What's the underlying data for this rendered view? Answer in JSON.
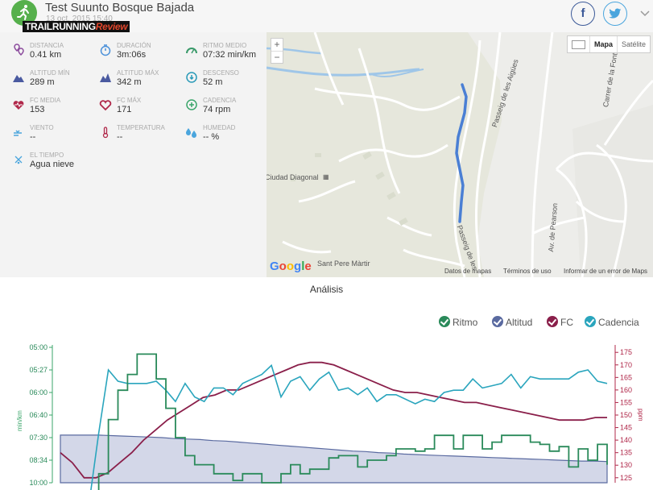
{
  "header": {
    "title": "Test Suunto Bosque Bajada",
    "date": "13 oct. 2015 15:40",
    "logo_main": "TRAILRUNNING",
    "logo_accent": "Review",
    "facebook_label": "f",
    "twitter_label": "t",
    "more_label": "v"
  },
  "stats": [
    {
      "label": "DISTANCIA",
      "value": "0.41 km",
      "icon": "distance-icon",
      "color": "#8b4a9c"
    },
    {
      "label": "DURACIÓN",
      "value": "3m:06s",
      "icon": "stopwatch-icon",
      "color": "#4a90d9"
    },
    {
      "label": "RITMO MEDIO",
      "value": "07:32 min/km",
      "icon": "pace-gauge-icon",
      "color": "#3a9a6a"
    },
    {
      "label": "ALTITUD MÍN",
      "value": "289 m",
      "icon": "mountain-icon",
      "color": "#4a5aa0"
    },
    {
      "label": "ALTITUD MÁX",
      "value": "342 m",
      "icon": "mountain-peak-icon",
      "color": "#4a5aa0"
    },
    {
      "label": "DESCENSO",
      "value": "52 m",
      "icon": "descent-icon",
      "color": "#2a9ab8"
    },
    {
      "label": "FC MEDIA",
      "value": "153",
      "icon": "heart-rate-icon",
      "color": "#b0284a"
    },
    {
      "label": "FC MÁX",
      "value": "171",
      "icon": "heart-icon",
      "color": "#b0284a"
    },
    {
      "label": "CADENCIA",
      "value": "74 rpm",
      "icon": "cadence-icon",
      "color": "#3aa56a"
    },
    {
      "label": "VIENTO",
      "value": "--",
      "icon": "wind-icon",
      "color": "#4aa5dd"
    },
    {
      "label": "TEMPERATURA",
      "value": "--",
      "icon": "thermometer-icon",
      "color": "#b0284a"
    },
    {
      "label": "HUMEDAD",
      "value": "-- %",
      "icon": "humidity-icon",
      "color": "#4aa5dd"
    },
    {
      "label": "EL TIEMPO",
      "value": "Agua nieve",
      "icon": "weather-icon",
      "color": "#4aa5dd"
    }
  ],
  "map": {
    "zoom_in": "+",
    "zoom_out": "−",
    "type_map": "Mapa",
    "type_satellite": "Satélite",
    "place_label": "Ciudad Diagonal",
    "place_label_2": "Sant Pere Màrtir",
    "streets": [
      "Passeig de les Aigües",
      "Carrer de la Font",
      "Av. de Pearson",
      "Passeig de les"
    ],
    "google_letters": [
      "G",
      "o",
      "o",
      "g",
      "l",
      "e"
    ],
    "attribution": [
      "Datos de mapas",
      "Términos de uso",
      "Informar de un error de Maps"
    ],
    "route_color": "#4a7fd4"
  },
  "analysis": {
    "title": "Análisis",
    "legend": [
      {
        "label": "Ritmo",
        "color": "#2a8a5a"
      },
      {
        "label": "Altitud",
        "color": "#5a6aa0"
      },
      {
        "label": "FC",
        "color": "#8a1f4a"
      },
      {
        "label": "Cadencia",
        "color": "#2aa5bd"
      }
    ]
  },
  "chart_data": {
    "type": "line",
    "xlabel": "",
    "y_left": {
      "label": "min/km",
      "ticks": [
        "05:00",
        "05:27",
        "06:00",
        "06:40",
        "07:30",
        "08:34",
        "10:00"
      ],
      "color": "#3aa56a"
    },
    "y_right": {
      "label": "ppm",
      "ticks": [
        175,
        170,
        165,
        160,
        155,
        150,
        145,
        140,
        135,
        130,
        125
      ],
      "ylim": [
        123,
        177
      ],
      "color": "#b0284a"
    },
    "grid": false,
    "series": [
      {
        "name": "Ritmo",
        "color": "#2a8a5a",
        "y_units": "pace_tick_index_0_top_6_bottom",
        "values": [
          6.9,
          6.9,
          6.9,
          6.9,
          5.6,
          3.2,
          1.9,
          1.2,
          0.3,
          0.3,
          1.4,
          2.7,
          4.0,
          4.8,
          5.2,
          5.2,
          5.6,
          5.6,
          5.9,
          5.6,
          5.6,
          6.0,
          6.0,
          5.6,
          5.2,
          5.6,
          5.4,
          5.4,
          4.9,
          4.8,
          4.8,
          5.3,
          5.0,
          5.0,
          4.8,
          4.5,
          4.5,
          4.6,
          4.5,
          3.9,
          3.9,
          4.5,
          3.9,
          3.9,
          4.5,
          4.2,
          3.9,
          3.9,
          3.9,
          4.2,
          4.3,
          4.6,
          4.4,
          5.3,
          4.5,
          5.0,
          4.3,
          5.2
        ]
      },
      {
        "name": "Altitud",
        "color": "#5a6aa0",
        "y_units": "m",
        "values": [
          342,
          342,
          342,
          342,
          341,
          340,
          339,
          338,
          337,
          335,
          334,
          333,
          331,
          330,
          328,
          326,
          324,
          322,
          320,
          318,
          316,
          314,
          312,
          310,
          309,
          307,
          306,
          304,
          303,
          302,
          301,
          300,
          299,
          298,
          297,
          296,
          295,
          294,
          293,
          292,
          291,
          290,
          290,
          289
        ]
      },
      {
        "name": "FC",
        "color": "#8a1f4a",
        "y_units": "ppm",
        "values": [
          135,
          131,
          125,
          125,
          127,
          131,
          135,
          140,
          144,
          148,
          151,
          154,
          157,
          158,
          160,
          160,
          162,
          164,
          166,
          168,
          170,
          171,
          171,
          170,
          168,
          166,
          164,
          162,
          160,
          159,
          159,
          158,
          157,
          156,
          155,
          155,
          154,
          153,
          152,
          151,
          150,
          149,
          148,
          148,
          148,
          149,
          149
        ]
      },
      {
        "name": "Cadencia",
        "color": "#2aa5bd",
        "y_units": "pace_tick_index_0_top_6_bottom",
        "values": [
          6.9,
          6.9,
          6.9,
          6.9,
          3.8,
          1.0,
          1.5,
          1.6,
          1.6,
          1.6,
          1.5,
          1.9,
          2.4,
          1.6,
          2.2,
          2.4,
          1.8,
          1.8,
          2.1,
          1.6,
          1.4,
          1.2,
          0.8,
          2.2,
          1.5,
          1.3,
          1.9,
          1.4,
          1.1,
          1.9,
          1.8,
          2.1,
          1.8,
          2.4,
          2.1,
          2.1,
          2.3,
          2.5,
          2.3,
          2.4,
          2.0,
          1.9,
          1.9,
          1.4,
          1.8,
          1.7,
          1.6,
          1.2,
          1.8,
          1.3,
          1.4,
          1.4,
          1.4,
          1.4,
          1.1,
          1.0,
          1.5,
          1.6
        ]
      }
    ]
  }
}
